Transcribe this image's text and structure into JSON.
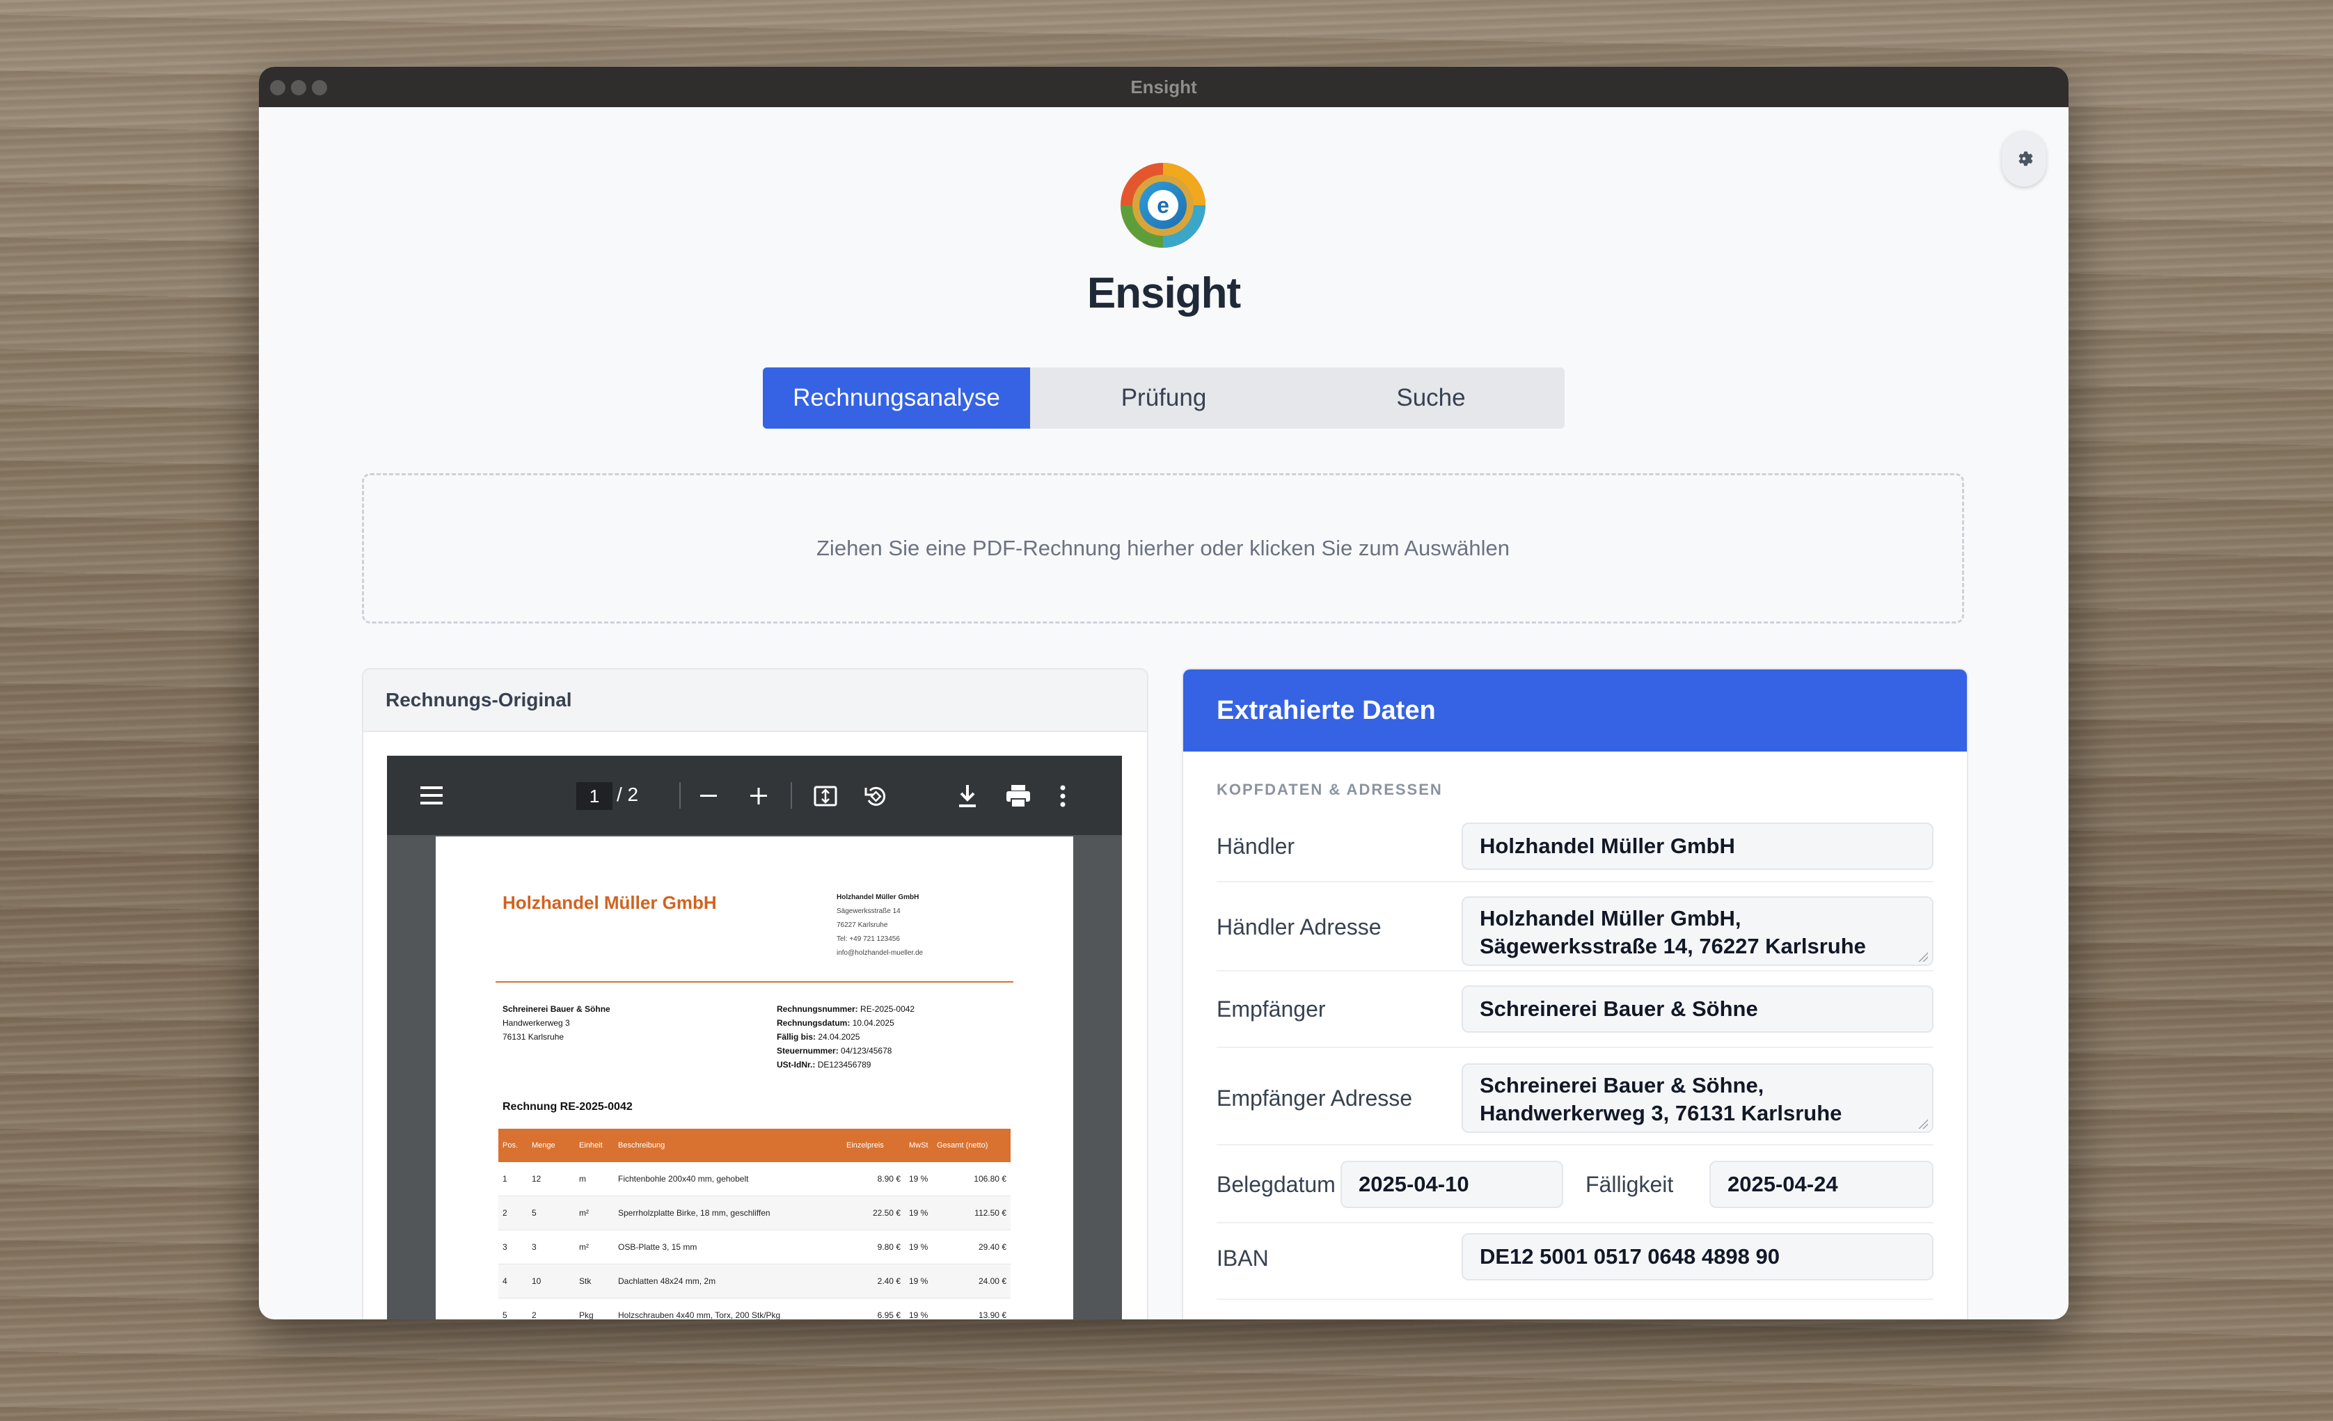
{
  "window": {
    "title": "Ensight"
  },
  "app": {
    "title": "Ensight",
    "logo_letter": "e"
  },
  "tabs": [
    {
      "label": "Rechnungsanalyse",
      "active": true
    },
    {
      "label": "Prüfung",
      "active": false
    },
    {
      "label": "Suche",
      "active": false
    }
  ],
  "dropzone": {
    "text": "Ziehen Sie eine PDF-Rechnung hierher oder klicken Sie zum Auswählen"
  },
  "original": {
    "title": "Rechnungs-Original",
    "viewer": {
      "page": "1",
      "total": "/  2"
    },
    "invoice": {
      "company": "Holzhandel Müller GmbH",
      "sender": [
        "Holzhandel Müller GmbH",
        "Sägewerksstraße 14",
        "76227 Karlsruhe",
        "Tel: +49 721 123456",
        "info@holzhandel-mueller.de"
      ],
      "recipient": [
        "Schreinerei Bauer & Söhne",
        "Handwerkerweg 3",
        "76131 Karlsruhe"
      ],
      "meta": [
        {
          "k": "Rechnungsnummer:",
          "v": "RE-2025-0042"
        },
        {
          "k": "Rechnungsdatum:",
          "v": "10.04.2025"
        },
        {
          "k": "Fällig bis:",
          "v": "24.04.2025"
        },
        {
          "k": "Steuernummer:",
          "v": "04/123/45678"
        },
        {
          "k": "USt-IdNr.:",
          "v": "DE123456789"
        }
      ],
      "heading": "Rechnung RE-2025-0042",
      "columns": [
        "Pos.",
        "Menge",
        "Einheit",
        "Beschreibung",
        "Einzelpreis",
        "MwSt",
        "Gesamt (netto)"
      ],
      "rows": [
        [
          "1",
          "12",
          "m",
          "Fichtenbohle 200x40 mm, gehobelt",
          "8.90 €",
          "19 %",
          "106.80 €"
        ],
        [
          "2",
          "5",
          "m²",
          "Sperrholzplatte Birke, 18 mm, geschliffen",
          "22.50 €",
          "19 %",
          "112.50 €"
        ],
        [
          "3",
          "3",
          "m²",
          "OSB-Platte 3, 15 mm",
          "9.80 €",
          "19 %",
          "29.40 €"
        ],
        [
          "4",
          "10",
          "Stk",
          "Dachlatten 48x24 mm, 2m",
          "2.40 €",
          "19 %",
          "24.00 €"
        ],
        [
          "5",
          "2",
          "Pkg",
          "Holzschrauben 4x40 mm, Torx, 200 Stk/Pkg",
          "6.95 €",
          "19 %",
          "13.90 €"
        ]
      ]
    }
  },
  "extracted": {
    "title": "Extrahierte Daten",
    "section": "KOPFDATEN & ADRESSEN",
    "fields": {
      "haendler": {
        "label": "Händler",
        "value": "Holzhandel Müller GmbH"
      },
      "haendler_adresse": {
        "label": "Händler Adresse",
        "value": "Holzhandel Müller GmbH, Sägewerksstraße 14, 76227 Karlsruhe"
      },
      "empfaenger": {
        "label": "Empfänger",
        "value": "Schreinerei Bauer & Söhne"
      },
      "empfaenger_adresse": {
        "label": "Empfänger Adresse",
        "value": "Schreinerei Bauer & Söhne, Handwerkerweg 3, 76131 Karlsruhe"
      },
      "belegdatum": {
        "label": "Belegdatum",
        "value": "2025-04-10"
      },
      "faelligkeit": {
        "label": "Fälligkeit",
        "value": "2025-04-24"
      },
      "iban": {
        "label": "IBAN",
        "value": "DE12 5001 0517 0648 4898 90"
      }
    }
  }
}
